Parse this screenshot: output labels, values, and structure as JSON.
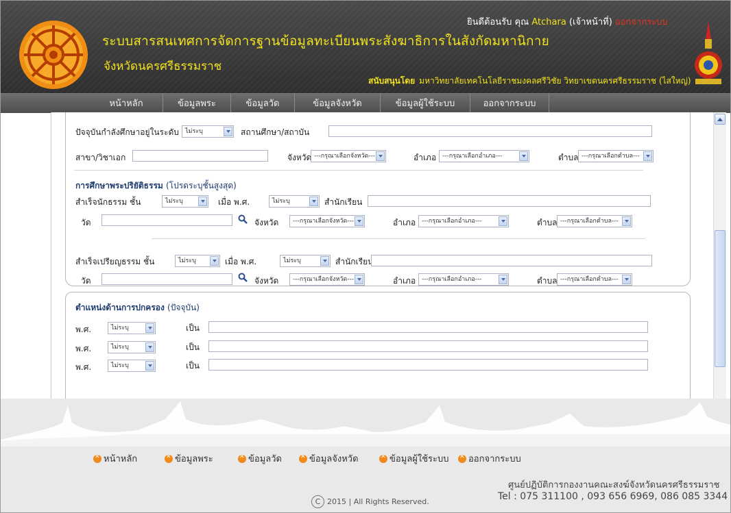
{
  "header": {
    "system_title": "ระบบสารสนเทศการจัดการฐานข้อมูลทะเบียนพระสังฆาธิการในสังกัดมหานิกาย",
    "system_subtitle": "จังหวัดนครศรีธรรมราช",
    "welcome_prefix": "ยินดีต้อนรับ คุณ",
    "user_name": "Atchara",
    "user_role": "(เจ้าหน้าที่)",
    "logout_label": "ออกจากระบบ",
    "support_label": "สนับสนุนโดย",
    "support_org": "มหาวิทยาลัยเทคโนโลยีราชมงคลศรีวิชัย วิทยาเขตนครศรีธรรมราช (ไสใหญ่)"
  },
  "nav": {
    "items": [
      "หน้าหลัก",
      "ข้อมูลพระ",
      "ข้อมูลวัด",
      "ข้อมูลจังหวัด",
      "ข้อมูลผู้ใช้ระบบ",
      "ออกจากระบบ"
    ]
  },
  "form": {
    "current_study": {
      "label": "ปัจจุบันกำลังศึกษาอยู่ในระดับ",
      "level_value": "ไม่ระบุ",
      "institution_label": "สถานศึกษา/สถาบัน",
      "major_label": "สาขา/วิชาเอก",
      "province_label": "จังหวัด",
      "province_value": "---กรุณาเลือกจังหวัด---",
      "district_label": "อำเภอ",
      "district_value": "---กรุณาเลือกอำเภอ---",
      "subdistrict_label": "ตำบล",
      "subdistrict_value": "---กรุณาเลือกตำบล---"
    },
    "dharma_section": {
      "title": "การศึกษาพระปริยัติธรรม",
      "title_note": "(โปรดระบุชั้นสูงสุด)",
      "nak_tham_label": "สำเร็จนักธรรม ชั้น",
      "nak_tham_value": "ไม่ระบุ",
      "year_label": "เมื่อ พ.ศ.",
      "year_value": "ไม่ระบุ",
      "school_label": "สำนักเรียน",
      "wat_label": "วัด",
      "province_label": "จังหวัด",
      "province_value": "---กรุณาเลือกจังหวัด---",
      "district_label": "อำเภอ",
      "district_value": "---กรุณาเลือกอำเภอ---",
      "subdistrict_label": "ตำบล",
      "subdistrict_value": "---กรุณาเลือกตำบล---",
      "pali_label": "สำเร็จเปรียญธรรม ชั้น",
      "pali_value": "ไม่ระบุ",
      "pali_year_label": "เมื่อ พ.ศ.",
      "pali_year_value": "ไม่ระบุ",
      "pali_school_label": "สำนักเรียน",
      "pali_wat_label": "วัด",
      "pali_province_label": "จังหวัด",
      "pali_province_value": "---กรุณาเลือกจังหวัด---",
      "pali_district_label": "อำเภอ",
      "pali_district_value": "---กรุณาเลือกอำเภอ---",
      "pali_subdistrict_label": "ตำบล",
      "pali_subdistrict_value": "---กรุณาเลือกตำบล---"
    },
    "admin_section": {
      "title": "ตำแหน่งด้านการปกครอง",
      "title_note": "(ปัจจุบัน)",
      "rows": [
        {
          "year_label": "พ.ศ.",
          "year_value": "ไม่ระบุ",
          "as_label": "เป็น"
        },
        {
          "year_label": "พ.ศ.",
          "year_value": "ไม่ระบุ",
          "as_label": "เป็น"
        },
        {
          "year_label": "พ.ศ.",
          "year_value": "ไม่ระบุ",
          "as_label": "เป็น"
        }
      ]
    }
  },
  "footer": {
    "nav": [
      "หน้าหลัก",
      "ข้อมูลพระ",
      "ข้อมูลวัด",
      "ข้อมูลจังหวัด",
      "ข้อมูลผู้ใช้ระบบ",
      "ออกจากระบบ"
    ],
    "org": "ศูนย์ปฏิบัติการกองงานคณะสงฆ์จังหวัดนครศรีธรรมราช",
    "tel": "Tel : 075 311100 , 093 656 6969, 086 085 3344",
    "copyright": "2015 | All Rights Reserved."
  },
  "colors": {
    "header_text": "#f2e21b",
    "logout": "#e0301e",
    "section_title": "#1f3b6e",
    "footer_icon": "#f08a1c"
  }
}
